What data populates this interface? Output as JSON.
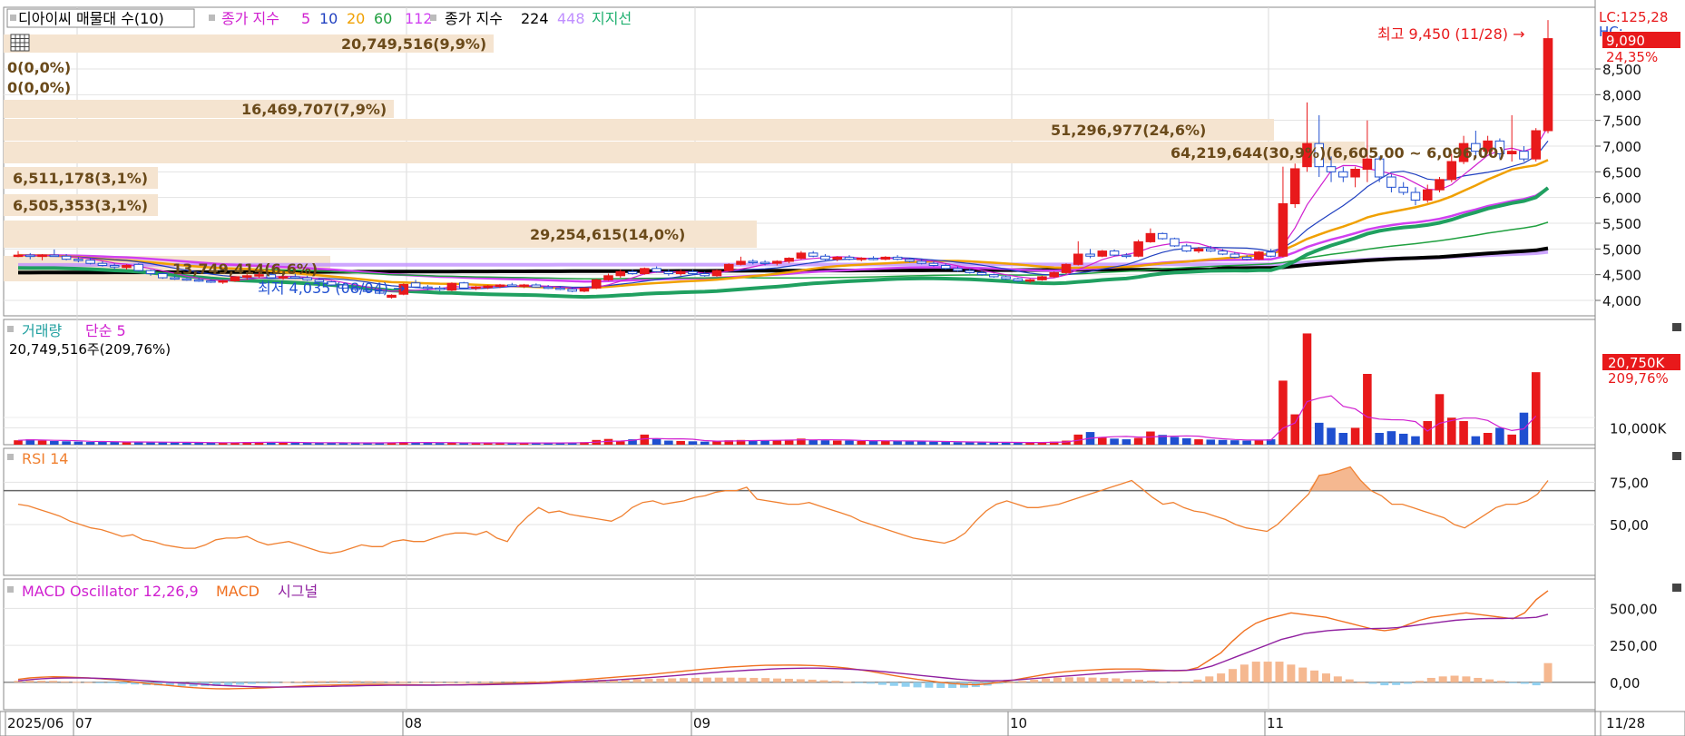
{
  "header": {
    "stock_name": "디아이씨 매물대 수(10)",
    "close_ma_label": "종가 지수",
    "ma_periods": [
      "5",
      "10",
      "20",
      "60",
      "112"
    ],
    "ma_colors": [
      "#d020d0",
      "#2040c0",
      "#f0a000",
      "#20a040",
      "#d040f0"
    ],
    "close_ma2_label": "종가 지수",
    "ma2_periods": [
      "224",
      "448"
    ],
    "ma2_colors": [
      "#000000",
      "#c090ff"
    ],
    "support_label": "지지선",
    "support_color": "#20b070"
  },
  "price_right": {
    "lc_label": "LC:125,28",
    "hc_label": "HC:",
    "current_price": "9,090",
    "current_change": "24,35%",
    "ticks": [
      "8,500",
      "8,000",
      "7,500",
      "7,000",
      "6,500",
      "6,000",
      "5,500",
      "5,000",
      "4,500",
      "4,000"
    ]
  },
  "annotations": {
    "high": "최고 9,450 (11/28) →",
    "low": "최저 4,035 (08/04) →"
  },
  "volume_profile": [
    {
      "label": "20,749,516(9,9%)"
    },
    {
      "label": "0(0,0%)"
    },
    {
      "label": "0(0,0%)"
    },
    {
      "label": "16,469,707(7,9%)"
    },
    {
      "label": "51,296,977(24,6%)"
    },
    {
      "label": "64,219,644(30,9%)(6,605,00 ~ 6,096,00)"
    },
    {
      "label": "6,511,178(3,1%)"
    },
    {
      "label": "6,505,353(3,1%)"
    },
    {
      "label": "29,254,615(14,0%)"
    },
    {
      "label": "13,749,414(6,6%)"
    }
  ],
  "volume_panel": {
    "title1": "거래량",
    "title2": "단순 5",
    "summary": "20,749,516주(209,76%)",
    "current": "20,750K",
    "current_pct": "209,76%",
    "tick": "10,000K"
  },
  "rsi_panel": {
    "title": "RSI 14",
    "ticks": [
      "75,00",
      "50,00"
    ]
  },
  "macd_panel": {
    "title1": "MACD Oscillator 12,26,9",
    "title2": "MACD",
    "title3": "시그널",
    "ticks": [
      "500,00",
      "250,00",
      "0,00"
    ]
  },
  "xaxis": {
    "labels": [
      "2025/06",
      "07",
      "08",
      "09",
      "10",
      "11"
    ],
    "right_label": "11/28"
  },
  "chart_data": {
    "type": "candlestick",
    "candle_colors": {
      "up": "#e8191b",
      "down": "#1f4fd0"
    },
    "candles": [
      [
        4880,
        4960,
        4840,
        4880
      ],
      [
        4880,
        4920,
        4800,
        4860
      ],
      [
        4860,
        4900,
        4780,
        4880
      ],
      [
        4880,
        4990,
        4860,
        4860
      ],
      [
        4860,
        4900,
        4780,
        4800
      ],
      [
        4800,
        4840,
        4740,
        4780
      ],
      [
        4780,
        4820,
        4700,
        4720
      ],
      [
        4720,
        4760,
        4660,
        4680
      ],
      [
        4680,
        4720,
        4600,
        4650
      ],
      [
        4640,
        4700,
        4600,
        4680
      ],
      [
        4700,
        4720,
        4560,
        4580
      ],
      [
        4580,
        4600,
        4480,
        4520
      ],
      [
        4520,
        4540,
        4420,
        4440
      ],
      [
        4440,
        4480,
        4400,
        4420
      ],
      [
        4420,
        4440,
        4380,
        4400
      ],
      [
        4400,
        4440,
        4360,
        4380
      ],
      [
        4380,
        4400,
        4340,
        4360
      ],
      [
        4360,
        4400,
        4320,
        4380
      ],
      [
        4380,
        4470,
        4360,
        4460
      ],
      [
        4450,
        4520,
        4400,
        4480
      ],
      [
        4480,
        4560,
        4440,
        4500
      ],
      [
        4500,
        4540,
        4420,
        4440
      ],
      [
        4440,
        4500,
        4400,
        4460
      ],
      [
        4460,
        4520,
        4420,
        4440
      ],
      [
        4440,
        4480,
        4380,
        4400
      ],
      [
        4400,
        4440,
        4340,
        4360
      ],
      [
        4360,
        4380,
        4280,
        4300
      ],
      [
        4300,
        4320,
        4220,
        4240
      ],
      [
        4240,
        4280,
        4180,
        4220
      ],
      [
        4200,
        4240,
        4140,
        4180
      ],
      [
        4180,
        4200,
        4120,
        4140
      ],
      [
        4060,
        4120,
        4035,
        4100
      ],
      [
        4120,
        4330,
        4100,
        4310
      ],
      [
        4340,
        4400,
        4240,
        4260
      ],
      [
        4260,
        4300,
        4200,
        4240
      ],
      [
        4240,
        4280,
        4180,
        4220
      ],
      [
        4200,
        4350,
        4180,
        4330
      ],
      [
        4340,
        4360,
        4220,
        4240
      ],
      [
        4240,
        4280,
        4200,
        4260
      ],
      [
        4250,
        4300,
        4220,
        4280
      ],
      [
        4270,
        4320,
        4240,
        4300
      ],
      [
        4300,
        4340,
        4260,
        4280
      ],
      [
        4280,
        4320,
        4240,
        4300
      ],
      [
        4300,
        4330,
        4250,
        4260
      ],
      [
        4260,
        4300,
        4220,
        4240
      ],
      [
        4240,
        4280,
        4200,
        4220
      ],
      [
        4220,
        4260,
        4160,
        4180
      ],
      [
        4180,
        4260,
        4160,
        4240
      ],
      [
        4240,
        4420,
        4220,
        4400
      ],
      [
        4400,
        4520,
        4380,
        4480
      ],
      [
        4480,
        4600,
        4440,
        4560
      ],
      [
        4560,
        4600,
        4500,
        4520
      ],
      [
        4520,
        4640,
        4500,
        4620
      ],
      [
        4620,
        4660,
        4540,
        4560
      ],
      [
        4560,
        4600,
        4480,
        4520
      ],
      [
        4520,
        4600,
        4480,
        4560
      ],
      [
        4560,
        4600,
        4500,
        4520
      ],
      [
        4520,
        4560,
        4460,
        4480
      ],
      [
        4480,
        4600,
        4460,
        4580
      ],
      [
        4580,
        4720,
        4560,
        4700
      ],
      [
        4700,
        4850,
        4680,
        4760
      ],
      [
        4760,
        4800,
        4700,
        4740
      ],
      [
        4740,
        4780,
        4680,
        4720
      ],
      [
        4720,
        4780,
        4680,
        4760
      ],
      [
        4760,
        4840,
        4720,
        4820
      ],
      [
        4820,
        4960,
        4800,
        4920
      ],
      [
        4920,
        4960,
        4840,
        4860
      ],
      [
        4860,
        4900,
        4780,
        4800
      ],
      [
        4800,
        4860,
        4760,
        4840
      ],
      [
        4840,
        4880,
        4780,
        4800
      ],
      [
        4800,
        4840,
        4760,
        4820
      ],
      [
        4820,
        4860,
        4780,
        4800
      ],
      [
        4800,
        4860,
        4780,
        4840
      ],
      [
        4840,
        4880,
        4780,
        4800
      ],
      [
        4800,
        4820,
        4740,
        4760
      ],
      [
        4760,
        4800,
        4700,
        4720
      ],
      [
        4720,
        4760,
        4660,
        4680
      ],
      [
        4680,
        4720,
        4600,
        4620
      ],
      [
        4620,
        4660,
        4560,
        4580
      ],
      [
        4580,
        4620,
        4520,
        4540
      ],
      [
        4540,
        4580,
        4480,
        4500
      ],
      [
        4500,
        4520,
        4440,
        4460
      ],
      [
        4460,
        4480,
        4400,
        4420
      ],
      [
        4420,
        4440,
        4360,
        4380
      ],
      [
        4380,
        4420,
        4340,
        4400
      ],
      [
        4400,
        4480,
        4380,
        4460
      ],
      [
        4460,
        4560,
        4440,
        4540
      ],
      [
        4540,
        4720,
        4520,
        4700
      ],
      [
        4700,
        5150,
        4680,
        4900
      ],
      [
        4900,
        5000,
        4820,
        4860
      ],
      [
        4860,
        4980,
        4840,
        4960
      ],
      [
        4960,
        4990,
        4860,
        4880
      ],
      [
        4880,
        4920,
        4820,
        4860
      ],
      [
        4860,
        5180,
        4840,
        5140
      ],
      [
        5140,
        5400,
        5120,
        5300
      ],
      [
        5300,
        5320,
        5180,
        5200
      ],
      [
        5200,
        5220,
        5040,
        5060
      ],
      [
        5060,
        5100,
        4940,
        4960
      ],
      [
        4960,
        5040,
        4920,
        5000
      ],
      [
        5000,
        5060,
        4940,
        4960
      ],
      [
        4960,
        5000,
        4880,
        4900
      ],
      [
        4900,
        4940,
        4820,
        4840
      ],
      [
        4840,
        4880,
        4780,
        4800
      ],
      [
        4800,
        4960,
        4780,
        4940
      ],
      [
        4940,
        5000,
        4840,
        4860
      ],
      [
        4860,
        6600,
        4840,
        5880
      ],
      [
        5880,
        6660,
        5800,
        6560
      ],
      [
        6600,
        7850,
        6500,
        7050
      ],
      [
        7050,
        7600,
        6400,
        6600
      ],
      [
        6600,
        6800,
        6300,
        6500
      ],
      [
        6500,
        6600,
        6300,
        6400
      ],
      [
        6400,
        6600,
        6200,
        6550
      ],
      [
        6550,
        7500,
        6300,
        6750
      ],
      [
        6750,
        6800,
        6300,
        6400
      ],
      [
        6400,
        6450,
        6100,
        6200
      ],
      [
        6200,
        6300,
        6050,
        6100
      ],
      [
        6100,
        6200,
        5850,
        5950
      ],
      [
        5950,
        6250,
        5900,
        6150
      ],
      [
        6150,
        6400,
        6100,
        6350
      ],
      [
        6350,
        6850,
        6300,
        6700
      ],
      [
        6700,
        7200,
        6650,
        7050
      ],
      [
        7050,
        7300,
        6800,
        6900
      ],
      [
        6900,
        7200,
        6850,
        7100
      ],
      [
        7100,
        7150,
        6750,
        6850
      ],
      [
        6850,
        7600,
        6700,
        6900
      ],
      [
        6900,
        7000,
        6700,
        6750
      ],
      [
        6750,
        7350,
        6700,
        7300
      ],
      [
        7300,
        9450,
        7250,
        9090
      ]
    ],
    "volume": [
      2.6,
      3.2,
      2.4,
      2.2,
      2.0,
      1.8,
      1.6,
      1.8,
      1.6,
      1.4,
      1.6,
      1.5,
      1.4,
      1.3,
      1.2,
      1.2,
      1.1,
      1.2,
      1.3,
      1.6,
      1.5,
      1.3,
      1.2,
      1.2,
      1.1,
      1.1,
      1.2,
      1.1,
      1.0,
      1.0,
      1.2,
      1.3,
      1.6,
      1.2,
      1.1,
      1.0,
      1.2,
      1.0,
      1.0,
      1.1,
      1.0,
      1.0,
      1.0,
      1.0,
      1.0,
      1.1,
      1.2,
      1.5,
      2.8,
      3.4,
      2.0,
      3.2,
      6.0,
      3.6,
      2.4,
      2.2,
      2.0,
      1.8,
      2.2,
      2.6,
      2.8,
      2.6,
      2.4,
      2.6,
      3.0,
      3.6,
      2.8,
      2.6,
      2.4,
      2.4,
      2.2,
      2.2,
      2.4,
      2.2,
      2.0,
      1.9,
      1.8,
      1.6,
      1.5,
      1.4,
      1.4,
      1.3,
      1.3,
      1.2,
      1.2,
      1.4,
      1.8,
      2.4,
      6.0,
      7.5,
      4.2,
      3.6,
      3.2,
      4.0,
      7.8,
      5.8,
      4.6,
      3.8,
      3.2,
      3.0,
      2.8,
      2.6,
      2.4,
      2.8,
      3.2,
      38,
      18,
      66,
      13,
      10,
      7,
      10,
      42,
      7,
      8,
      6.5,
      5,
      14,
      30,
      16,
      14,
      5,
      7,
      10,
      6,
      19,
      43
    ],
    "volume_colors_up_down": "candle",
    "ylim_price": [
      3700,
      9700
    ],
    "ylim_volume": [
      0,
      70
    ],
    "rsi": [
      62,
      61,
      59,
      57,
      55,
      52,
      50,
      48,
      47,
      45,
      43,
      44,
      41,
      40,
      38,
      37,
      36,
      36,
      38,
      41,
      42,
      42,
      43,
      40,
      38,
      39,
      40,
      38,
      36,
      34,
      33,
      34,
      36,
      38,
      37,
      37,
      40,
      41,
      40,
      40,
      42,
      44,
      45,
      45,
      44,
      46,
      42,
      40,
      49,
      55,
      60,
      57,
      58,
      56,
      55,
      54,
      53,
      52,
      55,
      60,
      63,
      64,
      62,
      63,
      64,
      66,
      67,
      69,
      70,
      70,
      72,
      65,
      64,
      63,
      62,
      62,
      63,
      61,
      59,
      57,
      55,
      52,
      50,
      48,
      46,
      44,
      42,
      41,
      40,
      39,
      41,
      45,
      52,
      58,
      62,
      64,
      62,
      60,
      60,
      61,
      62,
      64,
      66,
      68,
      70,
      72,
      74,
      76,
      71,
      66,
      62,
      63,
      60,
      58,
      57,
      55,
      53,
      50,
      48,
      47,
      46,
      50,
      56,
      62,
      68,
      79,
      80,
      82,
      84,
      76,
      70,
      67,
      62,
      62,
      60,
      58,
      56,
      54,
      50,
      48,
      52,
      56,
      60,
      62,
      62,
      64,
      68,
      76
    ],
    "rsi_ylim": [
      20,
      95
    ],
    "rsi_overbought": 70,
    "macd": [
      20,
      30,
      35,
      38,
      36,
      33,
      30,
      25,
      18,
      10,
      2,
      -8,
      -15,
      -22,
      -30,
      -36,
      -40,
      -43,
      -44,
      -42,
      -40,
      -38,
      -34,
      -30,
      -26,
      -22,
      -20,
      -18,
      -17,
      -15,
      -14,
      -14,
      -15,
      -16,
      -17,
      -18,
      -18,
      -17,
      -16,
      -14,
      -12,
      -10,
      -8,
      -6,
      -3,
      0,
      5,
      10,
      16,
      22,
      28,
      34,
      40,
      46,
      52,
      60,
      68,
      76,
      84,
      92,
      98,
      104,
      108,
      112,
      115,
      116,
      117,
      116,
      114,
      110,
      104,
      96,
      86,
      74,
      60,
      46,
      32,
      20,
      10,
      0,
      -8,
      -14,
      -16,
      -10,
      0,
      12,
      26,
      40,
      54,
      66,
      74,
      80,
      84,
      88,
      90,
      90,
      90,
      86,
      82,
      78,
      80,
      100,
      150,
      200,
      280,
      350,
      400,
      430,
      450,
      470,
      460,
      450,
      440,
      420,
      400,
      380,
      360,
      350,
      360,
      390,
      420,
      440,
      450,
      460,
      470,
      460,
      450,
      440,
      430,
      470,
      560,
      620
    ],
    "macd_signal": [
      10,
      18,
      24,
      28,
      30,
      30,
      29,
      27,
      24,
      20,
      16,
      11,
      6,
      1,
      -4,
      -9,
      -14,
      -19,
      -23,
      -26,
      -29,
      -31,
      -32,
      -32,
      -31,
      -30,
      -28,
      -27,
      -25,
      -24,
      -22,
      -21,
      -20,
      -20,
      -19,
      -19,
      -19,
      -18,
      -18,
      -17,
      -16,
      -15,
      -14,
      -12,
      -10,
      -8,
      -5,
      -2,
      2,
      6,
      10,
      14,
      19,
      24,
      29,
      35,
      41,
      47,
      54,
      60,
      66,
      72,
      77,
      82,
      86,
      90,
      93,
      95,
      96,
      96,
      94,
      92,
      88,
      83,
      77,
      70,
      62,
      54,
      46,
      38,
      30,
      22,
      16,
      12,
      10,
      12,
      16,
      22,
      28,
      34,
      40,
      46,
      52,
      58,
      63,
      68,
      72,
      75,
      77,
      79,
      80,
      82,
      90,
      110,
      140,
      170,
      200,
      230,
      260,
      290,
      310,
      330,
      340,
      350,
      355,
      360,
      362,
      364,
      366,
      370,
      380,
      390,
      400,
      410,
      420,
      425,
      430,
      432,
      432,
      434,
      436,
      440,
      460
    ],
    "macd_osc": [
      10,
      12,
      11,
      10,
      6,
      3,
      1,
      -2,
      -6,
      -10,
      -14,
      -19,
      -21,
      -23,
      -26,
      -27,
      -26,
      -24,
      -21,
      -16,
      -11,
      -7,
      -2,
      2,
      5,
      8,
      8,
      9,
      8,
      9,
      8,
      7,
      5,
      4,
      2,
      1,
      1,
      1,
      2,
      3,
      4,
      5,
      6,
      6,
      7,
      8,
      10,
      12,
      14,
      16,
      18,
      20,
      21,
      22,
      23,
      25,
      27,
      29,
      30,
      32,
      32,
      32,
      31,
      30,
      29,
      26,
      24,
      21,
      18,
      14,
      10,
      4,
      -2,
      -9,
      -17,
      -24,
      -30,
      -34,
      -36,
      -38,
      -38,
      -36,
      -32,
      -22,
      -10,
      0,
      10,
      18,
      26,
      32,
      34,
      34,
      32,
      30,
      27,
      22,
      18,
      12,
      5,
      1,
      0,
      18,
      40,
      60,
      90,
      120,
      140,
      140,
      140,
      120,
      100,
      80,
      60,
      40,
      20,
      0,
      -10,
      -20,
      -18,
      -10,
      10,
      30,
      40,
      45,
      40,
      30,
      20,
      10,
      -2,
      -10,
      -20,
      130
    ],
    "ma_lines_note": "moving averages and support line computed from candles"
  }
}
